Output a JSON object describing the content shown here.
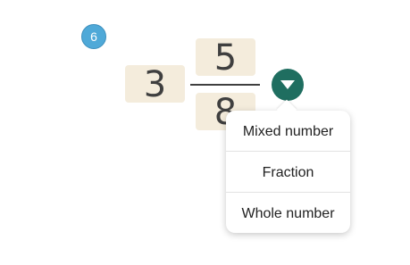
{
  "step": {
    "number": "6"
  },
  "mixed_number": {
    "whole": "3",
    "numerator": "5",
    "denominator": "8"
  },
  "dropdown": {
    "icon": "caret-down-icon",
    "accent_color": "#1f6e60"
  },
  "menu": {
    "items": [
      {
        "label": "Mixed number"
      },
      {
        "label": "Fraction"
      },
      {
        "label": "Whole number"
      }
    ]
  },
  "colors": {
    "input_box_background": "#f4ecdc",
    "step_badge": "#4fa9d8",
    "text": "#3f3f3f"
  }
}
